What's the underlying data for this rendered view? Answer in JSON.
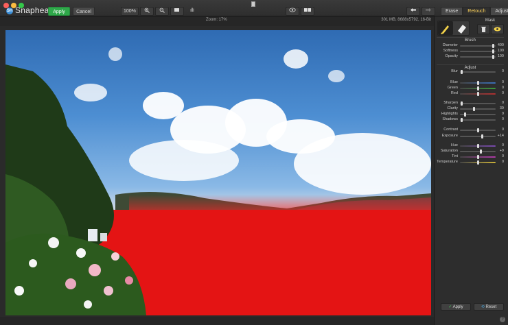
{
  "app": {
    "name": "Snapheal",
    "logo": "SH"
  },
  "titlebar": {
    "apply_label": "Apply",
    "cancel_label": "Cancel"
  },
  "zoom": {
    "percent_label": "100%"
  },
  "tabs": [
    {
      "label": "Erase"
    },
    {
      "label": "Retouch",
      "active": true
    },
    {
      "label": "Adjust"
    }
  ],
  "info": {
    "zoom_text": "Zoom: 17%",
    "meta": "301 MB, 8688x5792, 16-Bit"
  },
  "brush": {
    "mask_label": "Mask",
    "section_label": "Brush",
    "rows": [
      {
        "label": "Diameter",
        "value": "400",
        "fill": 0.95
      },
      {
        "label": "Softness",
        "value": "100",
        "fill": 0.95
      },
      {
        "label": "Opacity",
        "value": "100",
        "fill": 0.95
      }
    ]
  },
  "adjust": {
    "section_label": "Adjust",
    "rows": [
      {
        "label": "Blur",
        "value": "0",
        "fill": 0.02,
        "color": "#555555"
      },
      {
        "label": "Blue",
        "value": "0",
        "fill": 0.5,
        "color": "#3a6fb8"
      },
      {
        "label": "Green",
        "value": "0",
        "fill": 0.5,
        "color": "#3a9a3a"
      },
      {
        "label": "Red",
        "value": "0",
        "fill": 0.5,
        "color": "#b03030"
      },
      {
        "label": "Sharpen",
        "value": "0",
        "fill": 0.02,
        "color": "#555555"
      },
      {
        "label": "Clarity",
        "value": "39",
        "fill": 0.39,
        "color": "#555555"
      },
      {
        "label": "Highlights",
        "value": "9",
        "fill": 0.12,
        "color": "#555555"
      },
      {
        "label": "Shadows",
        "value": "0",
        "fill": 0.02,
        "color": "#555555"
      },
      {
        "label": "Contrast",
        "value": "0",
        "fill": 0.5,
        "color": "#555555"
      },
      {
        "label": "Exposure",
        "value": "+14",
        "fill": 0.64,
        "color": "#555555"
      },
      {
        "label": "Hue",
        "value": "0",
        "fill": 0.5,
        "color": "#7a4ab0"
      },
      {
        "label": "Saturation",
        "value": "+9",
        "fill": 0.59,
        "color": "#555555"
      },
      {
        "label": "Tint",
        "value": "0",
        "fill": 0.5,
        "color": "#b03aa8"
      },
      {
        "label": "Temperature",
        "value": "0",
        "fill": 0.5,
        "color": "#c9b038"
      }
    ]
  },
  "panel_buttons": {
    "apply": "Apply",
    "reset": "Reset"
  },
  "colors": {
    "accent_green": "#2fa84a",
    "active_tab": "#ffd45c",
    "mask_red": "#e41414"
  }
}
